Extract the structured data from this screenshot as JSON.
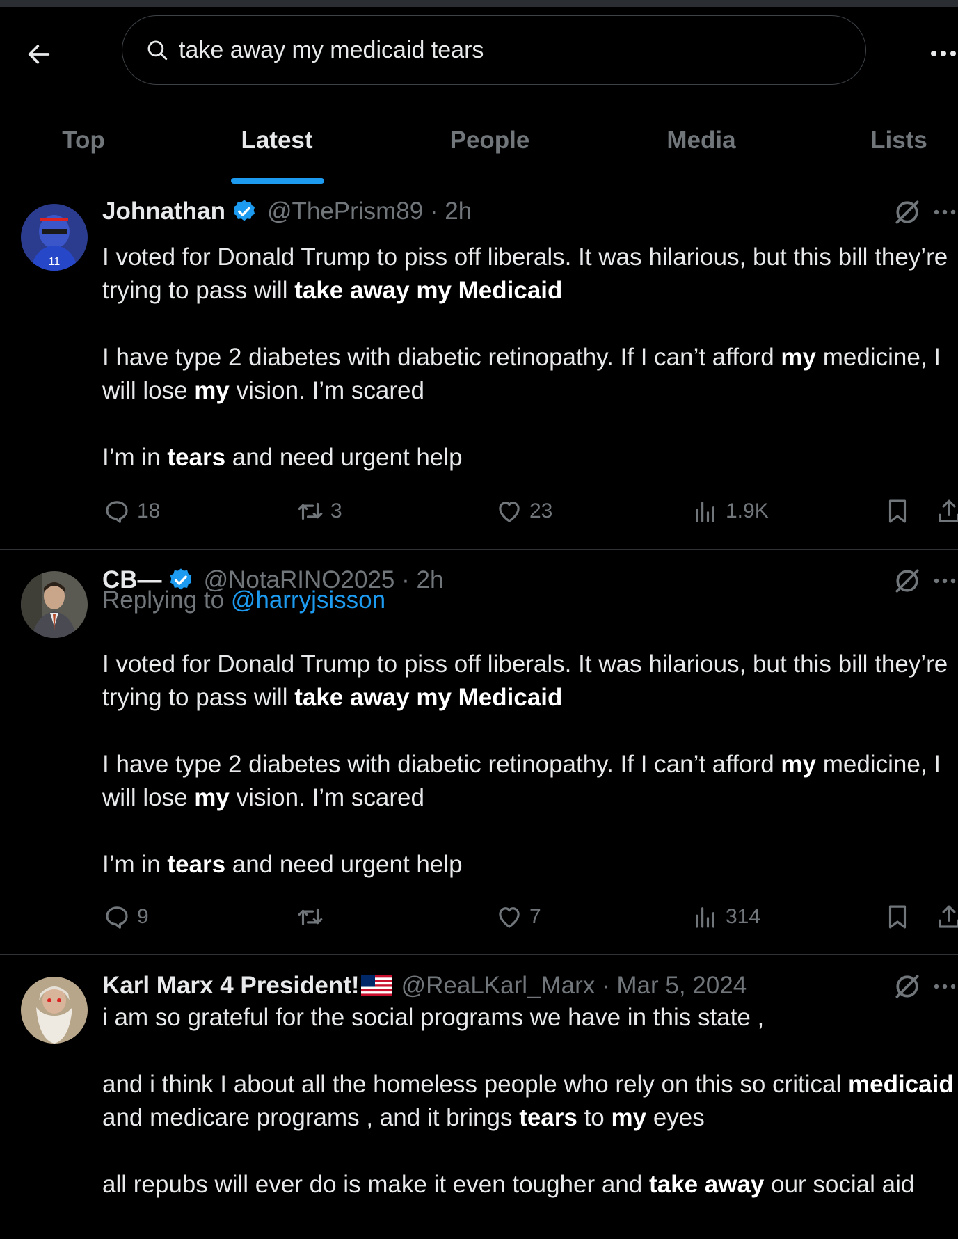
{
  "header": {
    "search_value": "take away my medicaid tears"
  },
  "tabs": [
    {
      "label": "Top"
    },
    {
      "label": "Latest"
    },
    {
      "label": "People"
    },
    {
      "label": "Media"
    },
    {
      "label": "Lists"
    }
  ],
  "active_tab": "Latest",
  "colors": {
    "background": "#000000",
    "accent": "#1d9bf0",
    "text": "#e7e9ea",
    "muted": "#71767b",
    "divider": "#2f3336"
  },
  "posts": [
    {
      "name": "Johnathan",
      "verified": true,
      "handle": "@ThePrism89",
      "time": "2h",
      "meta": "@ThePrism89 · 2h",
      "replies": "18",
      "reposts": "3",
      "likes": "23",
      "views": "1.9K",
      "avatar_icon": "football-player-avatar"
    },
    {
      "name": "CB—",
      "verified": true,
      "handle": "@NotaRINO2025",
      "time": "2h",
      "meta": "@NotaRINO2025 · 2h",
      "replying_prefix": "Replying to ",
      "replying_to": "@harryjsisson",
      "replies": "9",
      "reposts": "",
      "likes": "7",
      "views": "314",
      "avatar_icon": "man-in-suit-avatar"
    },
    {
      "name": "Karl Marx 4 President!",
      "flag_icon": "us-flag-icon",
      "verified": false,
      "handle": "@ReaLKarl_Marx",
      "time": "Mar 5, 2024",
      "meta": "@ReaLKarl_Marx · Mar 5, 2024",
      "avatar_icon": "bearded-man-avatar"
    }
  ],
  "text": {
    "s1": "I voted for Donald Trump to piss off liberals. It was hilarious, but this bill they’re trying to pass will ",
    "take_away_my_medicaid": "take away my Medicaid",
    "s2": "I have type 2 diabetes with diabetic retinopathy. If I can’t afford ",
    "my": "my",
    "s3": " medicine, I will lose ",
    "s4": " vision. I’m scared",
    "s5": "I’m in ",
    "tears": "tears",
    "s6": " and need urgent help",
    "k1": "i am so grateful for the social programs we have in this state ,",
    "k2": "and i think I about all the homeless people who rely on this so critical ",
    "medicaid": "medicaid",
    "k3": " and medicare programs , and it brings ",
    "k4": " to ",
    "k5": " eyes",
    "k6": "all repubs will ever do is make it even tougher and ",
    "take_away": "take away",
    "k7": " our social aid"
  }
}
